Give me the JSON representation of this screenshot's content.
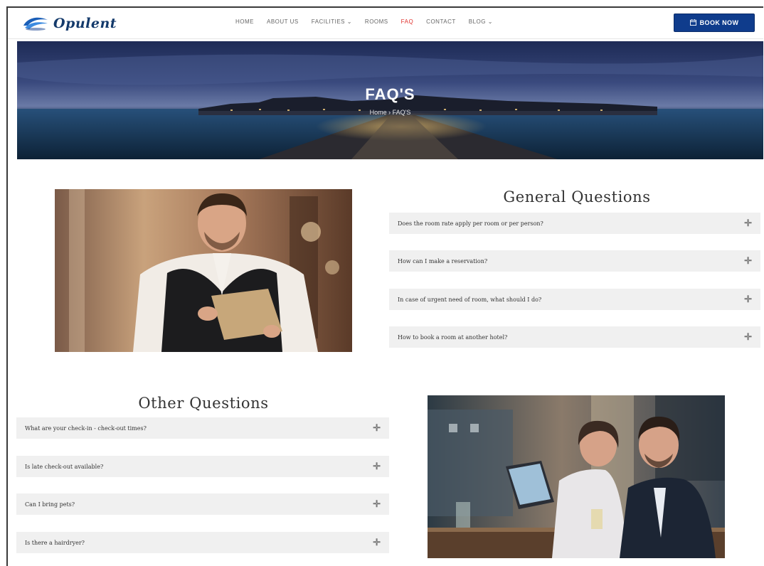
{
  "header": {
    "logo_text": "Opulent",
    "nav": [
      {
        "label": "HOME",
        "active": false
      },
      {
        "label": "ABOUT US",
        "active": false
      },
      {
        "label": "FACILITIES ⌄",
        "active": false
      },
      {
        "label": "ROOMS",
        "active": false
      },
      {
        "label": "FAQ",
        "active": true
      },
      {
        "label": "CONTACT",
        "active": false
      },
      {
        "label": "BLOG ⌄",
        "active": false
      }
    ],
    "book_label": "BOOK NOW"
  },
  "banner": {
    "title": "FAQ'S",
    "breadcrumb": "Home › FAQ'S"
  },
  "general": {
    "title": "General Questions",
    "items": [
      "Does the room rate apply per room or per person?",
      "How can I make a reservation?",
      "In case of urgent need of room, what should I do?",
      "How to book a room at another hotel?"
    ]
  },
  "other": {
    "title": "Other Questions",
    "items": [
      "What are your check-in - check-out times?",
      "Is late check-out available?",
      "Can I bring pets?",
      "Is there a hairdryer?"
    ]
  },
  "icons": {
    "expand": "plus-icon",
    "calendar": "calendar-icon"
  },
  "colors": {
    "brand": "#0f3c8c",
    "active_nav": "#e0312d",
    "faq_bg": "#f0f0f0"
  }
}
